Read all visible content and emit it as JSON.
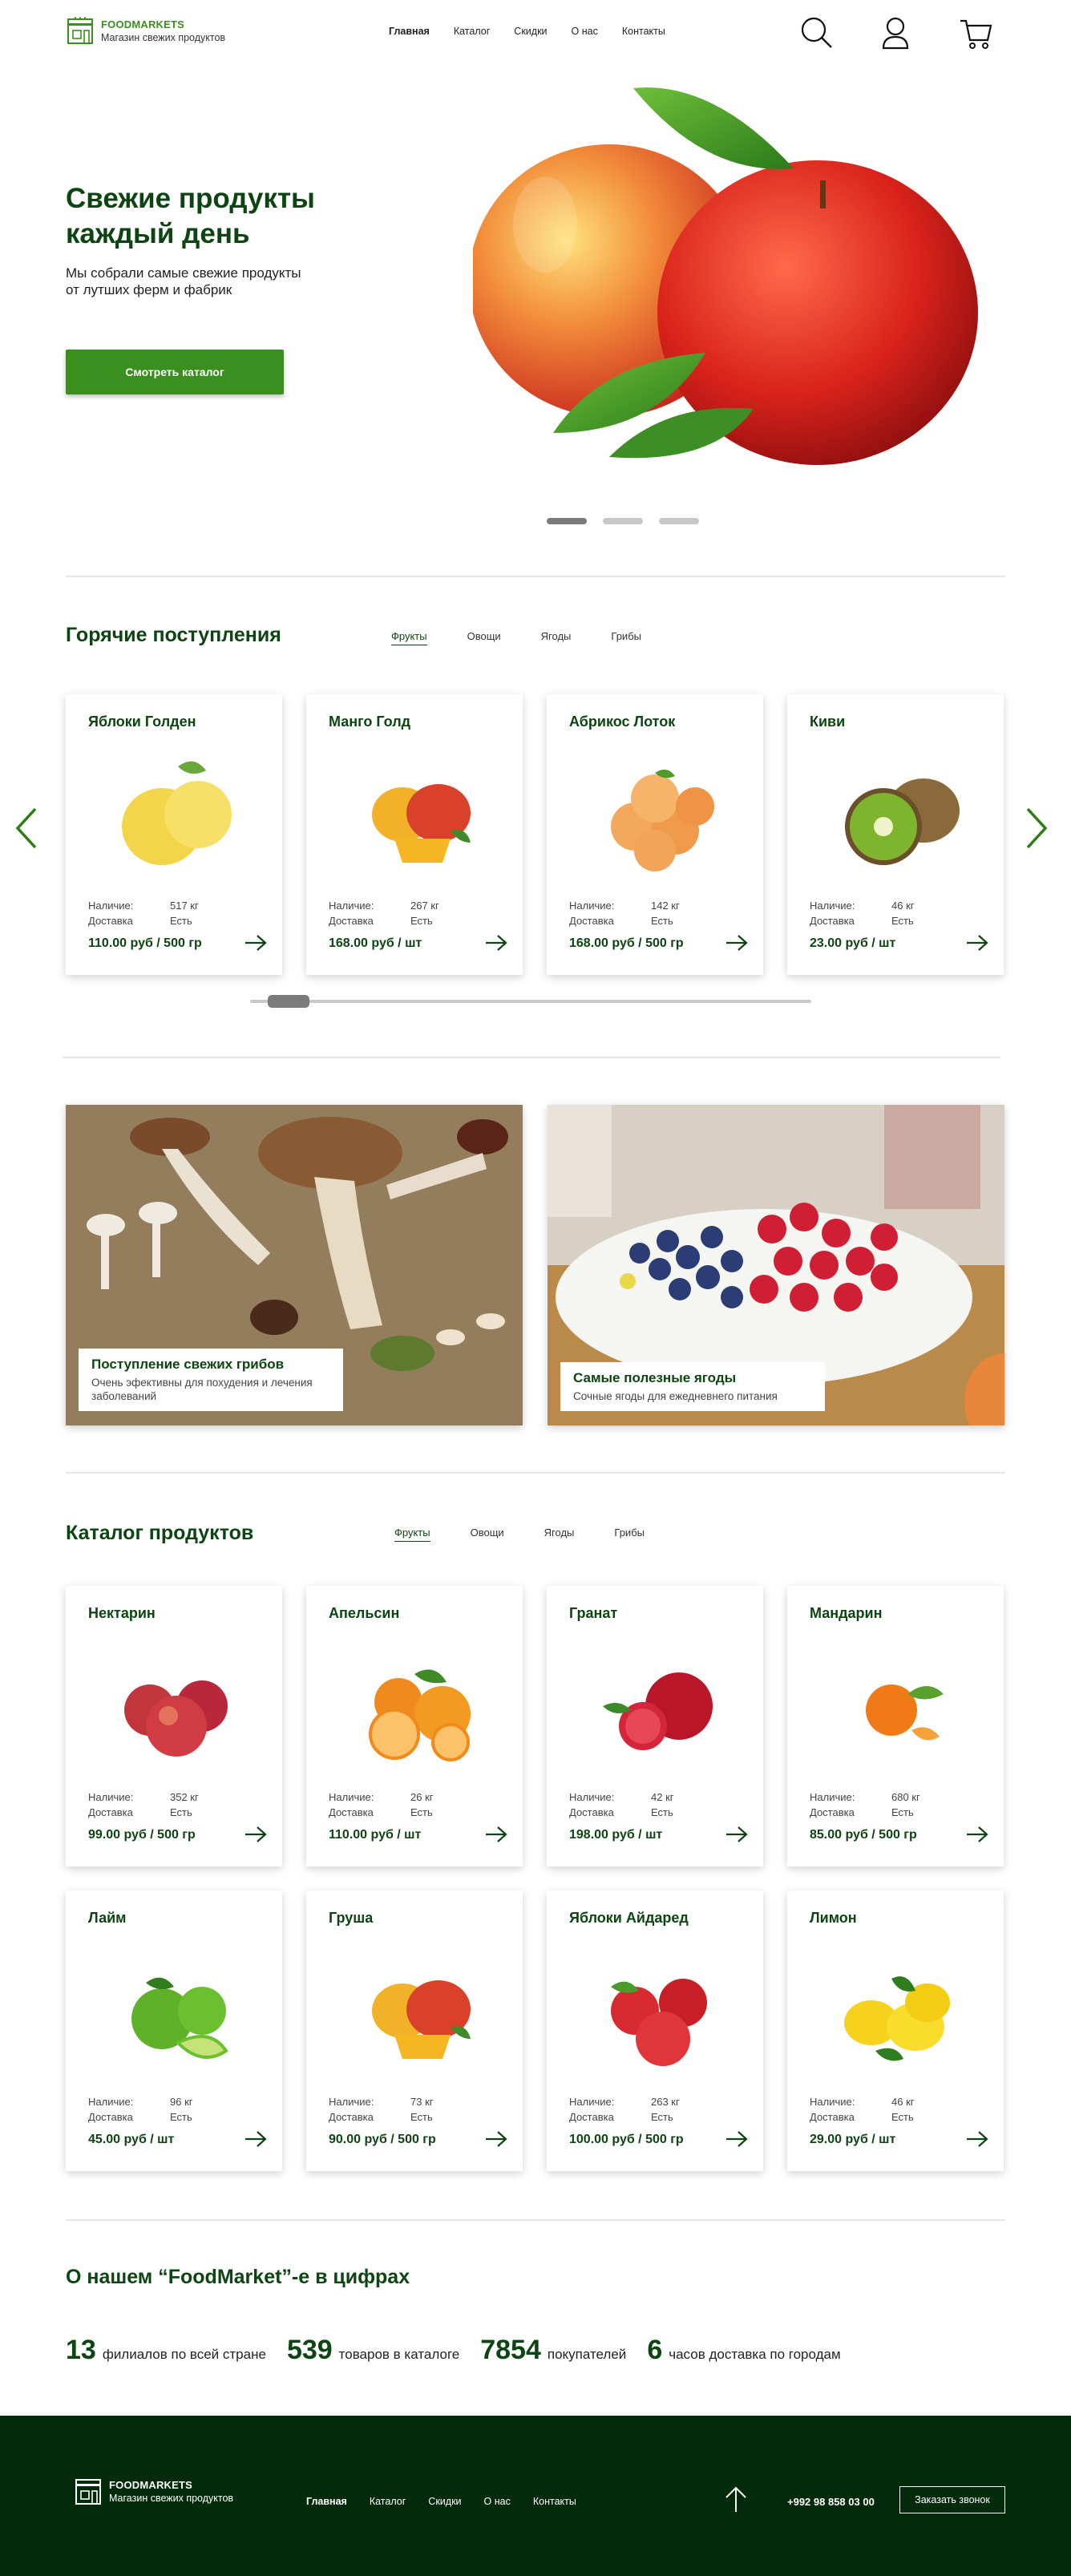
{
  "brand": {
    "name": "FOODMARKETS",
    "tagline": "Магазин свежих продуктов"
  },
  "nav": [
    "Главная",
    "Каталог",
    "Скидки",
    "О нас",
    "Контакты"
  ],
  "header_icons": [
    "search-icon",
    "user-icon",
    "cart-icon"
  ],
  "hero": {
    "title": "Свежие продукты каждый день",
    "text": "Мы собрали самые свежие продукты от лутших ферм и фабрик",
    "button": "Смотреть каталог",
    "slides": 3,
    "active_slide": 1
  },
  "hot": {
    "title": "Горячие поступления",
    "tabs": [
      "Фрукты",
      "Овощи",
      "Ягоды",
      "Грибы"
    ],
    "active_tab": "Фрукты",
    "scroll_position": 0.05,
    "items": [
      {
        "name": "Яблоки Голден",
        "stock": "517 кг",
        "delivery": "Есть",
        "price": "110.00 руб / 500 гр"
      },
      {
        "name": "Манго Голд",
        "stock": "267 кг",
        "delivery": "Есть",
        "price": "168.00 руб / шт"
      },
      {
        "name": "Абрикос Лоток",
        "stock": "142 кг",
        "delivery": "Есть",
        "price": "168.00 руб / 500 гр"
      },
      {
        "name": "Киви",
        "stock": "46 кг",
        "delivery": "Есть",
        "price": "23.00 руб / шт"
      }
    ]
  },
  "labels": {
    "stock": "Наличие:",
    "delivery": "Доставка"
  },
  "banners": [
    {
      "title": "Поступление свежих грибов",
      "text": "Очень эфективны для похудения и лечения заболеваний"
    },
    {
      "title": "Самые полезные ягоды",
      "text": "Сочные ягоды для ежедневнего питания"
    }
  ],
  "catalog": {
    "title": "Каталог продуктов",
    "tabs": [
      "Фрукты",
      "Овощи",
      "Ягоды",
      "Грибы"
    ],
    "active_tab": "Фрукты",
    "items": [
      {
        "name": "Нектарин",
        "stock": "352 кг",
        "delivery": "Есть",
        "price": "99.00 руб / 500 гр"
      },
      {
        "name": "Апельсин",
        "stock": "26 кг",
        "delivery": "Есть",
        "price": "110.00 руб / шт"
      },
      {
        "name": "Гранат",
        "stock": "42 кг",
        "delivery": "Есть",
        "price": "198.00 руб / шт"
      },
      {
        "name": "Мандарин",
        "stock": "680 кг",
        "delivery": "Есть",
        "price": "85.00 руб / 500 гр"
      },
      {
        "name": "Лайм",
        "stock": "96 кг",
        "delivery": "Есть",
        "price": "45.00 руб / шт"
      },
      {
        "name": "Груша",
        "stock": "73 кг",
        "delivery": "Есть",
        "price": "90.00 руб / 500 гр"
      },
      {
        "name": "Яблоки Айдаред",
        "stock": "263 кг",
        "delivery": "Есть",
        "price": "100.00 руб / 500 гр"
      },
      {
        "name": "Лимон",
        "stock": "46 кг",
        "delivery": "Есть",
        "price": "29.00 руб / шт"
      }
    ]
  },
  "about": {
    "title": "О нашем “FoodMarket”-е в цифрах",
    "stats": [
      {
        "n": "13",
        "l": "филиалов по всей стране"
      },
      {
        "n": "539",
        "l": "товаров в каталоге"
      },
      {
        "n": "7854",
        "l": "покупателей"
      },
      {
        "n": "6",
        "l": "часов доставка по городам"
      }
    ]
  },
  "footer": {
    "phone": "+992 98 858 03 00",
    "call_button": "Заказать звонок"
  },
  "colors": {
    "brand_green": "#3a8f1e",
    "dark_green": "#0d4512",
    "footer_bg": "#032a0b"
  }
}
